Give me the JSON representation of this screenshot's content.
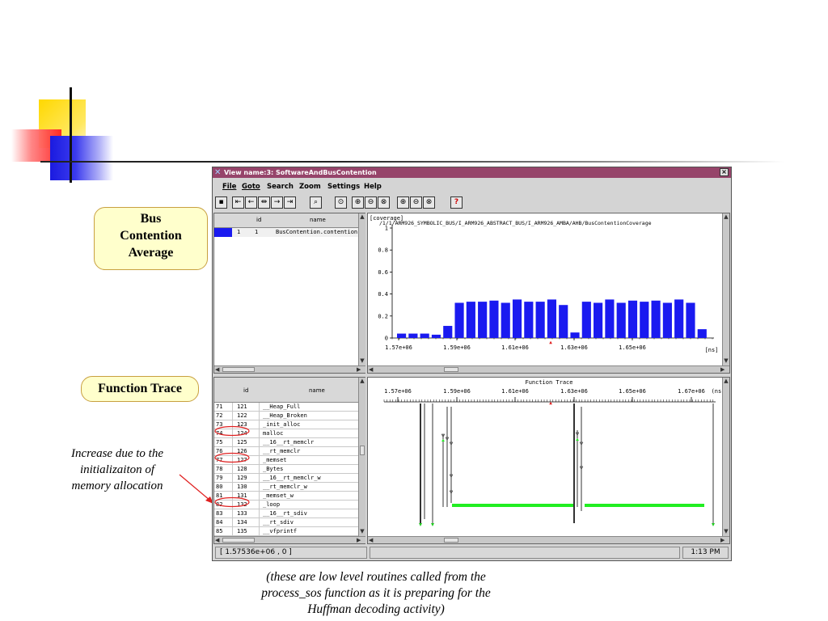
{
  "window": {
    "title": "View name:3: SoftwareAndBusContention",
    "close_glyph": "×",
    "menu": [
      "File",
      "Goto",
      "Search",
      "Zoom",
      "Settings",
      "Help"
    ]
  },
  "top_table": {
    "columns": [
      "id",
      "name"
    ],
    "rows": [
      {
        "index": "1",
        "id": "1",
        "name": "BusContention.contention"
      }
    ]
  },
  "coverage_chart": {
    "corner_label": "[coverage]",
    "path_label": "/1/1/ARM926_SYMBOLIC_BUS/I_ARM926_ABSTRACT_BUS/I_ARM926_AMBA/AHB/BusContentionCoverage",
    "y_ticks": [
      "1",
      "0.8",
      "0.6",
      "0.4",
      "0.2",
      "0"
    ],
    "x_ticks": [
      "1.57e+06",
      "1.59e+06",
      "1.61e+06",
      "1.63e+06",
      "1.65e+06"
    ],
    "x_unit": "[ns]",
    "bar_color": "#1a1af0"
  },
  "chart_data": {
    "type": "bar",
    "title": "",
    "ylabel": "[coverage]",
    "xlabel": "[ns]",
    "ylim": [
      0,
      1
    ],
    "values": [
      0.04,
      0.04,
      0.04,
      0.03,
      0.11,
      0.32,
      0.33,
      0.33,
      0.34,
      0.32,
      0.35,
      0.33,
      0.33,
      0.35,
      0.3,
      0.05,
      0.33,
      0.32,
      0.35,
      0.32,
      0.34,
      0.33,
      0.34,
      0.32,
      0.35,
      0.32,
      0.08
    ]
  },
  "function_table": {
    "columns": [
      "id",
      "name"
    ],
    "rows": [
      {
        "row": "71",
        "id": "121",
        "name": "__Heap_Full"
      },
      {
        "row": "72",
        "id": "122",
        "name": "__Heap_Broken"
      },
      {
        "row": "73",
        "id": "123",
        "name": "_init_alloc"
      },
      {
        "row": "74",
        "id": "124",
        "name": "malloc"
      },
      {
        "row": "75",
        "id": "125",
        "name": "__16__rt_memclr"
      },
      {
        "row": "76",
        "id": "126",
        "name": "__rt_memclr"
      },
      {
        "row": "77",
        "id": "127",
        "name": "_memset"
      },
      {
        "row": "78",
        "id": "128",
        "name": "_Bytes"
      },
      {
        "row": "79",
        "id": "129",
        "name": "__16__rt_memclr_w"
      },
      {
        "row": "80",
        "id": "130",
        "name": "__rt_memclr_w"
      },
      {
        "row": "81",
        "id": "131",
        "name": "_memset_w"
      },
      {
        "row": "82",
        "id": "132",
        "name": "_loop"
      },
      {
        "row": "83",
        "id": "133",
        "name": "__16__rt_sdiv"
      },
      {
        "row": "84",
        "id": "134",
        "name": "__rt_sdiv"
      },
      {
        "row": "85",
        "id": "135",
        "name": "__vfprintf"
      }
    ],
    "circled_rows": [
      "74",
      "77",
      "82"
    ]
  },
  "function_trace": {
    "title": "Function Trace",
    "x_ticks": [
      "1.57e+06",
      "1.59e+06",
      "1.61e+06",
      "1.63e+06",
      "1.65e+06",
      "1.67e+06"
    ],
    "x_unit": "(ns)",
    "bar_color": "#22ee22"
  },
  "status": {
    "coords": "[ 1.57536e+06 , 0 ]",
    "time": "1:13 PM"
  },
  "callouts": {
    "bus_contention": [
      "Bus",
      "Contention",
      "Average"
    ],
    "function_trace": "Function Trace",
    "increase_note": [
      "Increase due to the",
      "initializaiton of",
      "memory allocation"
    ],
    "bottom_note": [
      "(these are low level routines called from the",
      "process_sos function as it is preparing for the",
      "Huffman decoding activity)"
    ]
  },
  "colors": {
    "titlebar": "#96446a",
    "callout_fill": "#ffffcc",
    "selection": "#1a1af0",
    "circle": "#e02020"
  }
}
